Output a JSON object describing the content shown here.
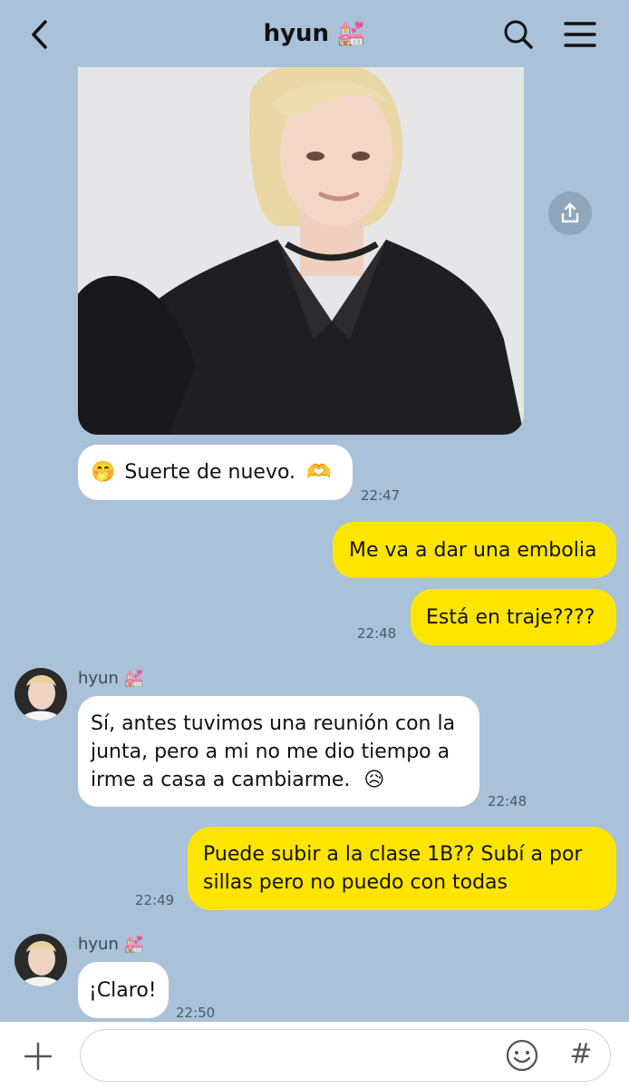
{
  "header": {
    "title": "hyun",
    "title_emoji": "💒"
  },
  "messages": {
    "m1": {
      "text": "Suerte de nuevo.",
      "lead_emoji": "🤭",
      "trail_emoji": "🫶",
      "time": "22:47"
    },
    "m2": {
      "text": "Me va a dar una embolia"
    },
    "m3": {
      "text": "Está en traje????",
      "time": "22:48"
    },
    "m4": {
      "sender": "hyun",
      "sender_emoji": "💒",
      "line1": "Sí, antes tuvimos una reunión con la",
      "line2": "junta, pero a mi no me dio tiempo a",
      "line3": "irme a casa a cambiarme.",
      "trail_emoji": "😥",
      "time": "22:48"
    },
    "m5": {
      "line1": "Puede subir a la clase 1B?? Subí a por",
      "line2": "sillas pero no puedo con todas",
      "time": "22:49"
    },
    "m6": {
      "sender": "hyun",
      "sender_emoji": "💒",
      "text": "¡Claro!",
      "time": "22:50"
    }
  },
  "input": {
    "placeholder": "",
    "hash_label": "#"
  },
  "colors": {
    "background": "#a9c1d9",
    "outgoing": "#fee500",
    "incoming": "#ffffff"
  }
}
